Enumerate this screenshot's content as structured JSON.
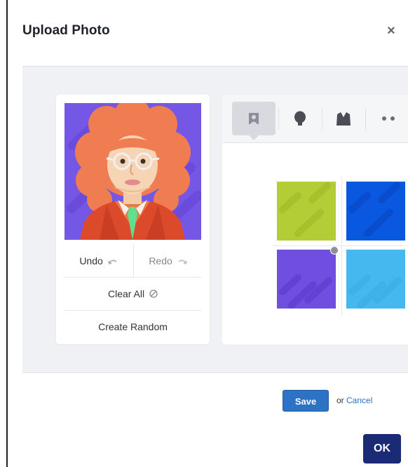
{
  "dialog": {
    "title": "Upload Photo",
    "close_glyph": "×"
  },
  "preview": {
    "undo_label": "Undo",
    "redo_label": "Redo",
    "clear_label": "Clear All",
    "random_label": "Create Random"
  },
  "tabs": [
    {
      "name": "background",
      "icon": "portrait-icon",
      "active": true
    },
    {
      "name": "hair",
      "icon": "head-silhouette-icon",
      "active": false
    },
    {
      "name": "clothes",
      "icon": "jacket-icon",
      "active": false
    },
    {
      "name": "eyes",
      "icon": "eyes-icon",
      "active": false
    }
  ],
  "swatches": [
    {
      "color": "#b2cd36",
      "selected": false
    },
    {
      "color": "#0a57e0",
      "selected": false
    },
    {
      "color": "#6e4fe0",
      "selected": true
    },
    {
      "color": "#45b9ef",
      "selected": false
    }
  ],
  "footer": {
    "save_label": "Save",
    "or_label": "or",
    "cancel_label": "Cancel",
    "ok_label": "OK"
  },
  "colors": {
    "accent": "#2d72c4",
    "ok_button": "#1b2a74",
    "avatar_background": "#7557e6",
    "hair": "#f07c52",
    "tie": "#5fe08e"
  }
}
